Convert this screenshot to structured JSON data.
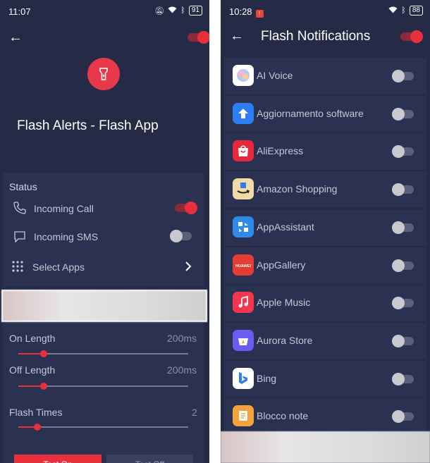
{
  "left_screen": {
    "status_bar": {
      "time": "11:07",
      "battery": "91"
    },
    "app_title": "Flash Alerts - Flash App",
    "master_toggle_on": true,
    "status_section": {
      "label": "Status",
      "incoming_call": {
        "label": "Incoming Call",
        "enabled": true
      },
      "incoming_sms": {
        "label": "Incoming SMS",
        "enabled": false
      },
      "select_apps": {
        "label": "Select Apps"
      }
    },
    "sliders": [
      {
        "label": "On Length",
        "value": "200ms",
        "fraction": 0.15
      },
      {
        "label": "Off Length",
        "value": "200ms",
        "fraction": 0.15
      },
      {
        "label": "Flash Times",
        "value": "2",
        "fraction": 0.11
      }
    ],
    "buttons": {
      "test_on": "Test On",
      "test_off": "Test Off"
    }
  },
  "right_screen": {
    "status_bar": {
      "time": "10:28",
      "battery": "88"
    },
    "title": "Flash Notifications",
    "master_toggle_on": true,
    "apps": [
      {
        "name": "AI Voice",
        "icon": "ai-voice-icon",
        "color": "#ffffff",
        "enabled": false
      },
      {
        "name": "Aggiornamento software",
        "icon": "update-arrow-icon",
        "color": "#2f7df2",
        "enabled": false
      },
      {
        "name": "AliExpress",
        "icon": "aliexpress-bag-icon",
        "color": "#e8293b",
        "enabled": false
      },
      {
        "name": "Amazon Shopping",
        "icon": "amazon-icon",
        "color": "#f3d9a6",
        "enabled": false
      },
      {
        "name": "AppAssistant",
        "icon": "app-assistant-icon",
        "color": "#2f8ae8",
        "enabled": false
      },
      {
        "name": "AppGallery",
        "icon": "huawei-icon",
        "color": "#e53d36",
        "enabled": false
      },
      {
        "name": "Apple Music",
        "icon": "music-note-icon",
        "color": "#f4364f",
        "enabled": false
      },
      {
        "name": "Aurora Store",
        "icon": "aurora-store-icon",
        "color": "#6a5cf0",
        "enabled": false
      },
      {
        "name": "Bing",
        "icon": "bing-icon",
        "color": "#ffffff",
        "enabled": false
      },
      {
        "name": "Blocco note",
        "icon": "notes-icon",
        "color": "#f3a33a",
        "enabled": false
      }
    ]
  },
  "colors": {
    "background": "#252a47",
    "card": "#2b3150",
    "accent": "#e8303c"
  }
}
